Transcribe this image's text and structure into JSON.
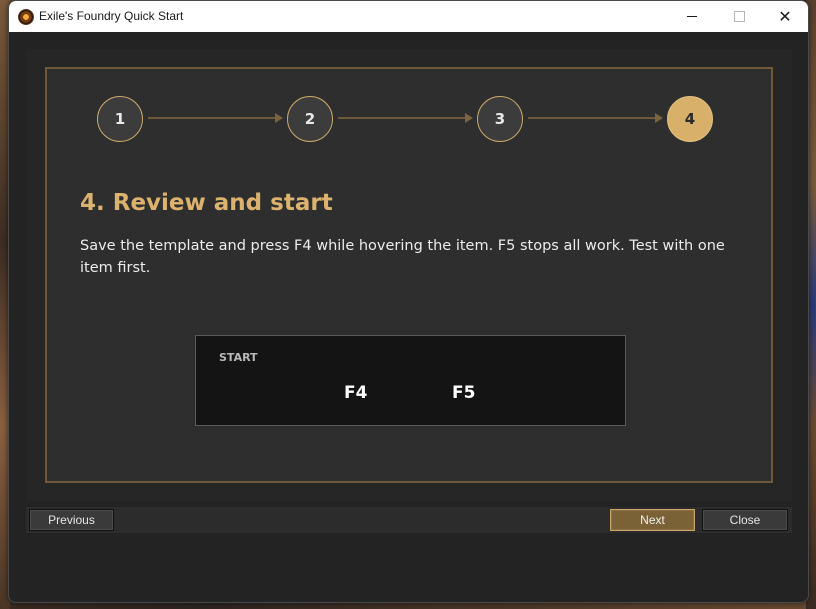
{
  "window": {
    "title": "Exile's Foundry Quick Start",
    "icon": "app-orb-icon"
  },
  "steps": [
    {
      "number": "1",
      "state": "done"
    },
    {
      "number": "2",
      "state": "done"
    },
    {
      "number": "3",
      "state": "done"
    },
    {
      "number": "4",
      "state": "active"
    }
  ],
  "content": {
    "heading": "4. Review and start",
    "description": "Save the template and press F4 while hovering the item. F5 stops all work. Test with one item first."
  },
  "keys": {
    "label": "START",
    "start_key": "F4",
    "stop_key": "F5"
  },
  "buttons": {
    "previous": "Previous",
    "next": "Next",
    "close": "Close"
  },
  "colors": {
    "accent": "#dcb36e",
    "active_step": "#d8b06a",
    "panel_border": "#6e5a38",
    "background": "#232323"
  }
}
